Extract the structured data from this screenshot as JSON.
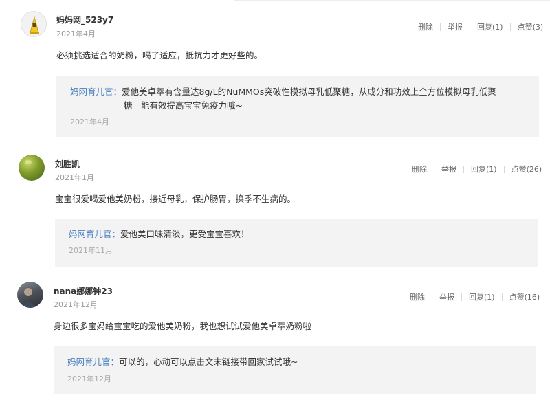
{
  "comments": [
    {
      "username": "妈妈网_523y7",
      "date": "2021年4月",
      "actions": {
        "delete": "删除",
        "report": "举报",
        "reply": "回复(1)",
        "like": "点赞(3)"
      },
      "content": "必须挑选适合的奶粉，喝了适应，抵抗力才更好些的。",
      "reply": {
        "author": "妈网育儿官：",
        "text_line1": "爱他美卓萃有含量达8g/L的NuMMOs突破性模拟母乳低聚糖，从成分和功效上全方位模拟母乳低聚",
        "text_line2": "糖。能有效提高宝宝免疫力哦~",
        "date": "2021年4月"
      }
    },
    {
      "username": "刘胜凯",
      "date": "2021年1月",
      "actions": {
        "delete": "删除",
        "report": "举报",
        "reply": "回复(1)",
        "like": "点赞(26)"
      },
      "content": "宝宝很爱喝爱他美奶粉，接近母乳，保护肠胃，换季不生病的。",
      "reply": {
        "author": "妈网育儿官：",
        "text_line1": "爱他美口味清淡，更受宝宝喜欢！",
        "date": "2021年11月"
      }
    },
    {
      "username": "nana娜娜钟23",
      "date": "2021年12月",
      "actions": {
        "delete": "删除",
        "report": "举报",
        "reply": "回复(1)",
        "like": "点赞(16)"
      },
      "content": "身边很多宝妈给宝宝吃的爱他美奶粉，我也想试试爱他美卓萃奶粉啦",
      "reply": {
        "author": "妈网育儿官：",
        "text_line1": "可以的，心动可以点击文末链接带回家试试哦~",
        "date": "2021年12月"
      }
    }
  ]
}
